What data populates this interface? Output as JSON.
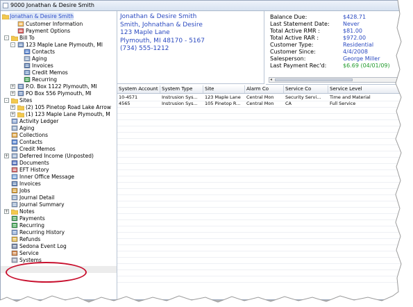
{
  "window": {
    "title": "9000 Jonathan & Desire Smith"
  },
  "tree": {
    "root": "Jonathan & Desire Smith",
    "items": [
      {
        "label": "Customer Information",
        "icon": "customer-info-icon"
      },
      {
        "label": "Payment Options",
        "icon": "payment-options-icon"
      },
      {
        "label": "Bill To",
        "icon": "folder-icon"
      },
      {
        "label": "123 Maple Lane Plymouth, MI",
        "icon": "bill-to-address-icon"
      },
      {
        "label": "Contacts",
        "icon": "contacts-icon"
      },
      {
        "label": "Aging",
        "icon": "aging-icon"
      },
      {
        "label": "Invoices",
        "icon": "invoices-icon"
      },
      {
        "label": "Credit Memos",
        "icon": "credit-memos-icon"
      },
      {
        "label": "Recurring",
        "icon": "recurring-icon"
      },
      {
        "label": "P.O. Box 1122 Plymouth, MI",
        "icon": "bill-to-address-icon"
      },
      {
        "label": "PO Box 556 Plymouth, MI",
        "icon": "bill-to-address-icon"
      },
      {
        "label": "Sites",
        "icon": "folder-icon"
      },
      {
        "label": "(2) 105 Pinetop Road Lake Arrow",
        "icon": "folder-icon"
      },
      {
        "label": "(1) 123 Maple Lane Plymouth, M",
        "icon": "folder-icon"
      },
      {
        "label": "Activity Ledger",
        "icon": "activity-ledger-icon"
      },
      {
        "label": "Aging",
        "icon": "aging-icon"
      },
      {
        "label": "Collections",
        "icon": "collections-icon"
      },
      {
        "label": "Contacts",
        "icon": "contacts-icon"
      },
      {
        "label": "Credit Memos",
        "icon": "credit-memos-icon"
      },
      {
        "label": "Deferred Income (Unposted)",
        "icon": "deferred-income-icon"
      },
      {
        "label": "Documents",
        "icon": "documents-icon"
      },
      {
        "label": "EFT History",
        "icon": "eft-history-icon"
      },
      {
        "label": "Inner Office Message",
        "icon": "inner-office-message-icon"
      },
      {
        "label": "Invoices",
        "icon": "invoices-icon"
      },
      {
        "label": "Jobs",
        "icon": "jobs-icon"
      },
      {
        "label": "Journal Detail",
        "icon": "journal-detail-icon"
      },
      {
        "label": "Journal Summary",
        "icon": "journal-summary-icon"
      },
      {
        "label": "Notes",
        "icon": "folder-icon"
      },
      {
        "label": "Payments",
        "icon": "payments-icon"
      },
      {
        "label": "Recurring",
        "icon": "recurring-icon"
      },
      {
        "label": "Recurring History",
        "icon": "recurring-history-icon"
      },
      {
        "label": "Refunds",
        "icon": "refunds-icon"
      },
      {
        "label": "Sedona Event Log",
        "icon": "event-log-icon"
      },
      {
        "label": "Service",
        "icon": "service-icon"
      },
      {
        "label": "Systems",
        "icon": "systems-icon"
      }
    ]
  },
  "contact": {
    "name": "Jonathan & Desire Smith",
    "line2": "Smith, Johnathan & Desire",
    "address": "123 Maple Lane",
    "city": "Plymouth, MI  48170 - 5167",
    "phone": "(734) 555-1212"
  },
  "summary": {
    "rows": [
      {
        "label": "Balance Due:",
        "value": "$428.71"
      },
      {
        "label": "Last Statement Date:",
        "value": "Never"
      },
      {
        "label": "Total Active RMR :",
        "value": "$81.00"
      },
      {
        "label": "Total Active RAR :",
        "value": "$972.00"
      },
      {
        "label": "Customer Type:",
        "value": "Residential"
      },
      {
        "label": "Customer Since:",
        "value": "4/4/2008"
      },
      {
        "label": "Salesperson:",
        "value": "George Miller"
      },
      {
        "label": "Last Payment Rec'd:",
        "value": "$6.69 (04/01/09)"
      }
    ],
    "last_payment_color": "#1f9a2a"
  },
  "grid": {
    "columns": [
      "System Account",
      "System Type",
      "Site",
      "Alarm Co",
      "Service Co",
      "Service Level"
    ],
    "rows": [
      [
        "10-4571",
        "Instrusion Sys...",
        "123 Maple Lane",
        "Central Mon",
        "Security Servi...",
        "Time and Material"
      ],
      [
        "4565",
        "Instrusion Sys...",
        "105 Pinetop R...",
        "Central Mon",
        "CA",
        "Full Service"
      ]
    ]
  },
  "colors": {
    "accent": "#2b4ac0",
    "highlight_circle": "#c8102e"
  }
}
